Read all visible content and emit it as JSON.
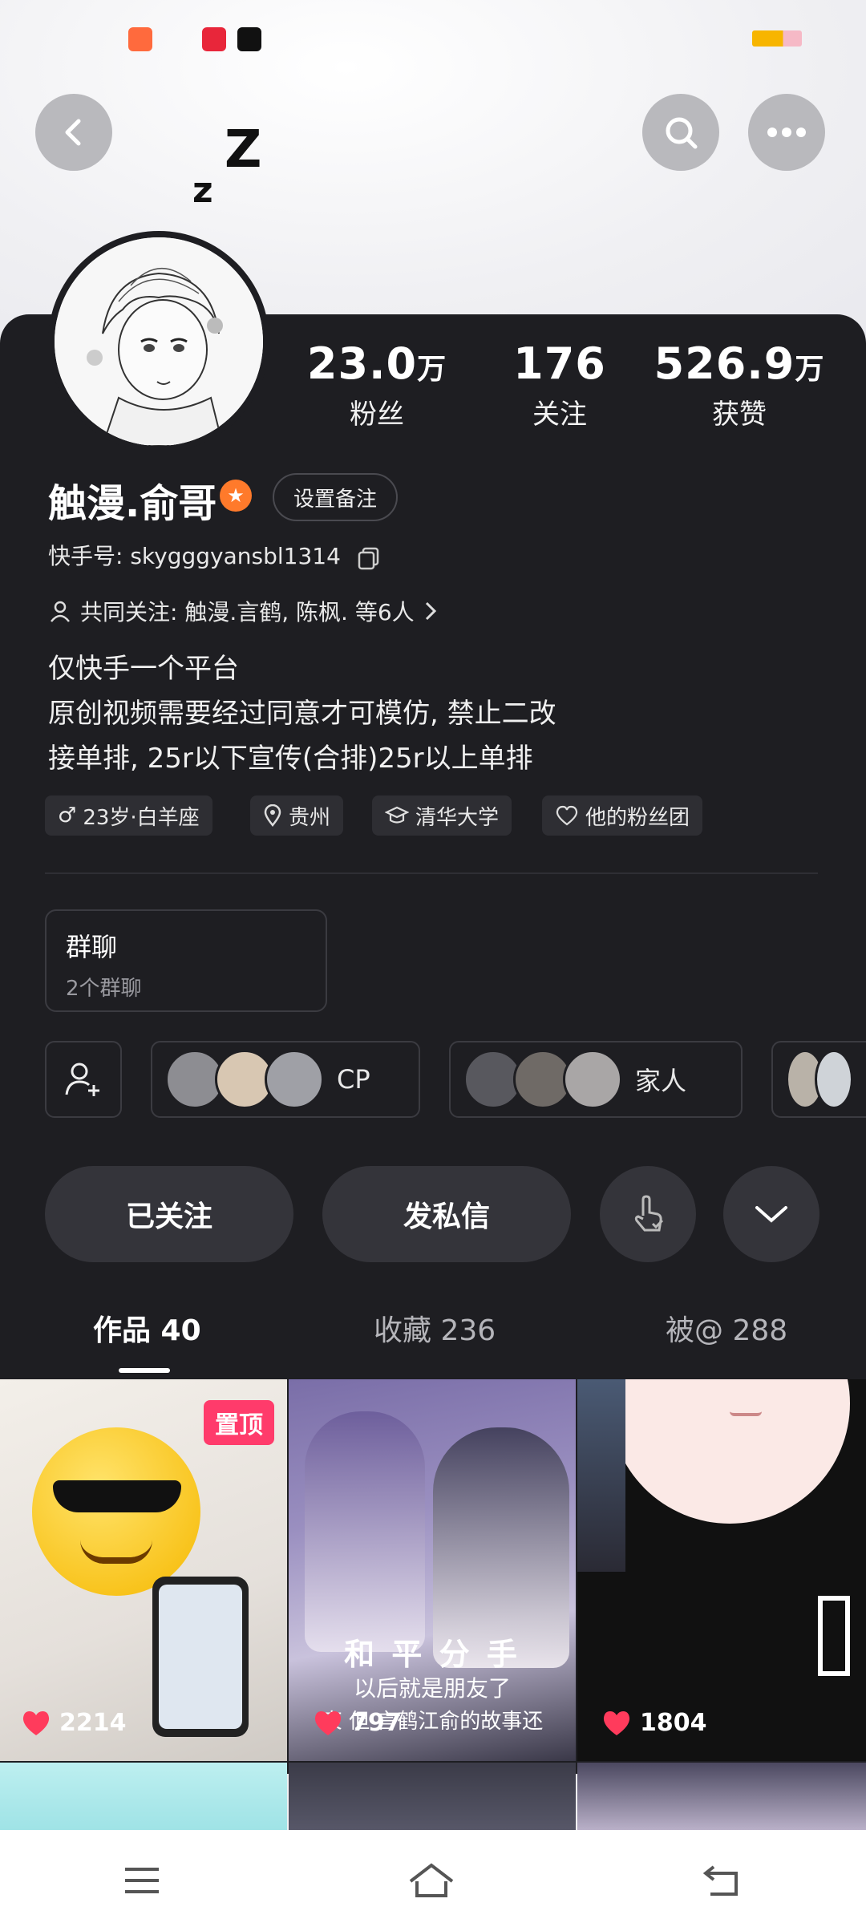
{
  "status_bar": {
    "colors": {
      "app1": "#ff6a3d",
      "app2": "#e8263a",
      "app3": "#111111"
    },
    "icons": [
      "kuaishou-app-icon",
      "xiaohongshu-app-icon",
      "video-app-icon",
      "battery-icon"
    ]
  },
  "header": {
    "back_icon": "chevron-left-icon",
    "search_icon": "search-icon",
    "more_icon": "ellipsis-icon",
    "doodle": [
      "Z",
      "z"
    ]
  },
  "profile": {
    "stats": [
      {
        "value": "23.0",
        "unit": "万",
        "label": "粉丝"
      },
      {
        "value": "176",
        "unit": "",
        "label": "关注"
      },
      {
        "value": "526.9",
        "unit": "万",
        "label": "获赞"
      }
    ],
    "name": "触漫.俞哥",
    "remark_button": "设置备注",
    "kuaishou_id": "快手号: skygggyansbl1314",
    "mutual_follow": "共同关注: 触漫.言鹤, 陈枫. 等6人",
    "bio": [
      "仅快手一个平台",
      "原创视频需要经过同意才可模仿, 禁止二改",
      "接单排, 25r以下宣传(合排)25r以上单排"
    ],
    "tags": [
      {
        "icon": "male-icon",
        "label": "23岁·白羊座"
      },
      {
        "icon": "location-icon",
        "label": "贵州"
      },
      {
        "icon": "graduation-cap-icon",
        "label": "清华大学"
      },
      {
        "icon": "heart-outline-icon",
        "label": "他的粉丝团"
      }
    ]
  },
  "group_chat": {
    "title": "群聊",
    "subtitle": "2个群聊"
  },
  "relation_chips": [
    {
      "label": "CP",
      "colors": [
        "#8d8d92",
        "#d8c7b2",
        "#9fa0a6"
      ]
    },
    {
      "label": "家人",
      "colors": [
        "#58585e",
        "#6f6a66",
        "#a9a6a6"
      ]
    },
    {
      "label": "",
      "colors": [
        "#b9b2a8",
        "#cfd3d8"
      ]
    }
  ],
  "actions": {
    "followed": "已关注",
    "message": "发私信",
    "gesture_icon": "tap-hand-icon",
    "expand_icon": "chevron-down-icon",
    "add_friend_icon": "add-user-icon"
  },
  "tabs": [
    {
      "label": "作品 40",
      "active": true
    },
    {
      "label": "收藏 236",
      "active": false
    },
    {
      "label": "被@ 288",
      "active": false
    }
  ],
  "works": [
    {
      "likes": "2214",
      "pinned_label": "置顶"
    },
    {
      "likes": "797",
      "caption_main": "和 平 分 手",
      "caption_sub1": "以后就是朋友了",
      "caption_sub2": "東    但    言鹤江俞的故事还"
    },
    {
      "likes": "1804"
    }
  ],
  "nav_bar": {
    "icons": [
      "menu-icon",
      "home-icon",
      "back-arrow-icon"
    ]
  }
}
